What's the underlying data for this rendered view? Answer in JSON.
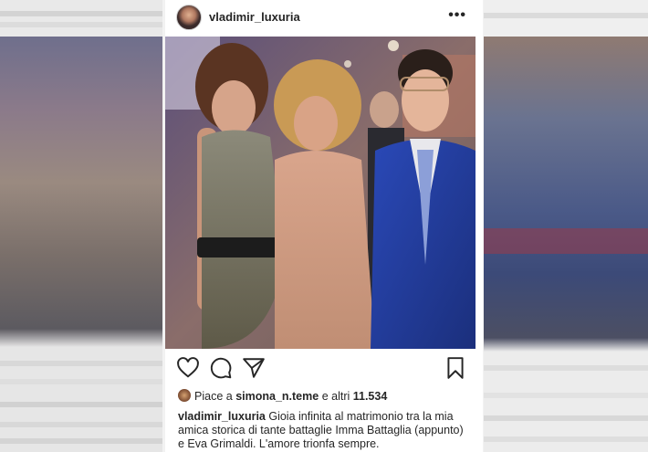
{
  "post": {
    "username": "vladimir_luxuria",
    "more_label": "•••",
    "likes_prefix": "Piace a",
    "likes_user": "simona_n.teme",
    "likes_connector": "e altri",
    "likes_count": "11.534",
    "caption_user": "vladimir_luxuria",
    "caption_text": "Gioia infinita al matrimonio tra la mia amica storica di tante battaglie Imma Battaglia (appunto) e Eva Grimaldi. L'amore trionfa sempre."
  },
  "icons": {
    "like": "heart-icon",
    "comment": "comment-icon",
    "share": "paper-plane-icon",
    "save": "bookmark-icon"
  }
}
